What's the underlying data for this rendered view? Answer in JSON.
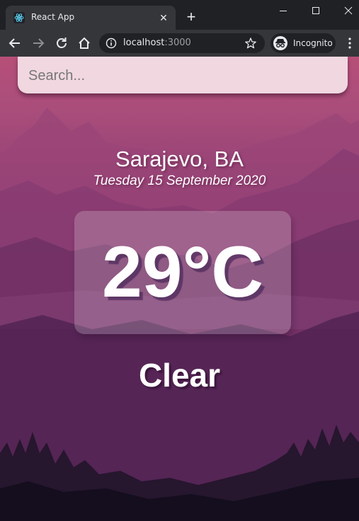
{
  "browser": {
    "tab": {
      "title": "React App",
      "favicon": "react-logo-icon"
    },
    "address_bar": {
      "host": "localhost",
      "port": ":3000"
    },
    "profile": {
      "label": "Incognito",
      "icon": "incognito-icon"
    }
  },
  "app": {
    "search": {
      "placeholder": "Search...",
      "value": ""
    },
    "location": "Sarajevo, BA",
    "date": "Tuesday 15 September 2020",
    "temperature": "29°C",
    "condition": "Clear"
  },
  "colors": {
    "chrome_frame": "#202124",
    "chrome_toolbar": "#35363a",
    "sky_top": "#b64f78",
    "ground_bottom": "#171222",
    "text": "#ffffff"
  }
}
